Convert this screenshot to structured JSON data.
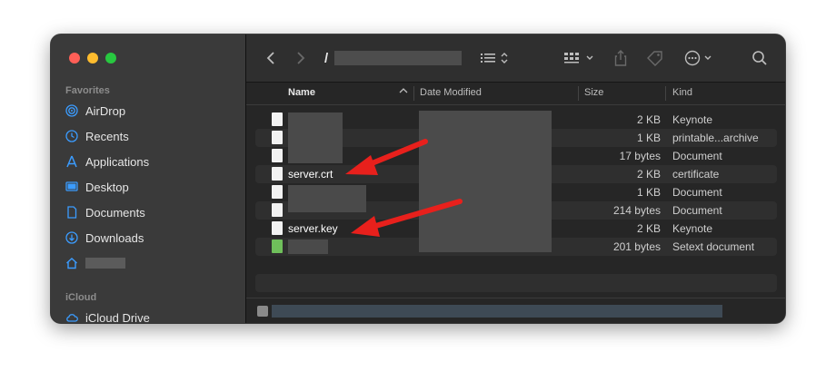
{
  "sidebar": {
    "favorites_label": "Favorites",
    "favorites": [
      {
        "label": "AirDrop",
        "icon": "airdrop-icon"
      },
      {
        "label": "Recents",
        "icon": "clock-icon"
      },
      {
        "label": "Applications",
        "icon": "applications-icon"
      },
      {
        "label": "Desktop",
        "icon": "desktop-icon"
      },
      {
        "label": "Documents",
        "icon": "document-icon"
      },
      {
        "label": "Downloads",
        "icon": "download-icon"
      }
    ],
    "icloud_label": "iCloud",
    "icloud_drive": "iCloud Drive"
  },
  "toolbar": {
    "path_prefix": "/"
  },
  "columns": {
    "name": "Name",
    "date_modified": "Date Modified",
    "size": "Size",
    "kind": "Kind"
  },
  "files": [
    {
      "name": "",
      "size": "2 KB",
      "kind": "Keynote"
    },
    {
      "name": "",
      "size": "1 KB",
      "kind": "printable...archive"
    },
    {
      "name": "",
      "size": "17 bytes",
      "kind": "Document"
    },
    {
      "name": "server.crt",
      "size": "2 KB",
      "kind": "certificate"
    },
    {
      "name": "",
      "size": "1 KB",
      "kind": "Document"
    },
    {
      "name": "",
      "size": "214 bytes",
      "kind": "Document"
    },
    {
      "name": "server.key",
      "size": "2 KB",
      "kind": "Keynote"
    },
    {
      "name": "",
      "size": "201 bytes",
      "kind": "Setext document"
    }
  ],
  "colors": {
    "annotation_arrow": "#e8201c",
    "accent_blue": "#3b9cff"
  }
}
